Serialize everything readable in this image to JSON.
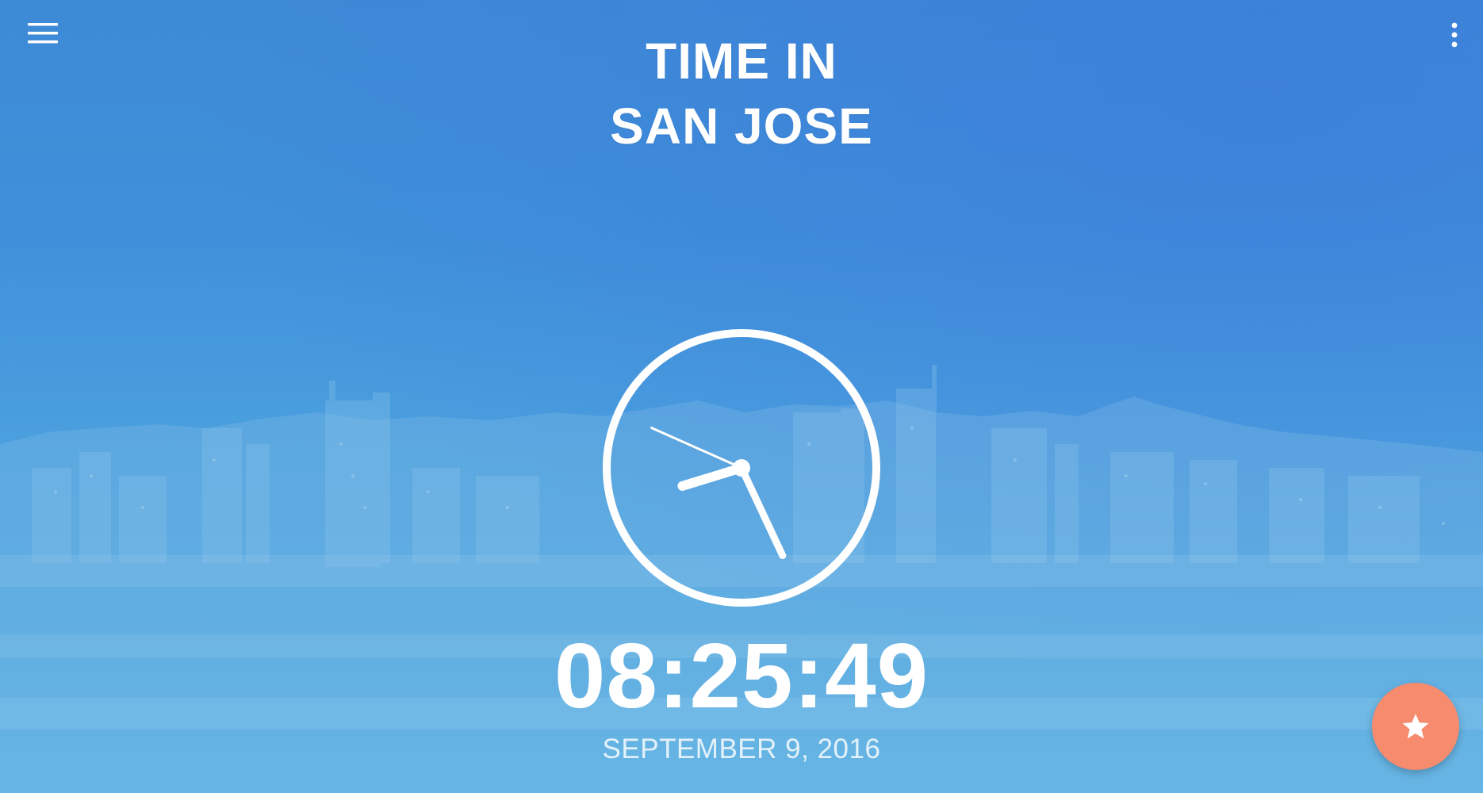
{
  "header": {
    "title_line1": "TIME IN",
    "title_line2": "SAN JOSE",
    "menu_icon": "hamburger-menu-icon",
    "overflow_icon": "more-vert-icon"
  },
  "clock": {
    "analog_hours": 8,
    "analog_minutes": 25,
    "analog_seconds": 49
  },
  "time_display": {
    "time": "08:25:49",
    "date": "SEPTEMBER 9, 2016"
  },
  "fab": {
    "icon": "star-icon",
    "color": "#f78b6d"
  },
  "colors": {
    "background_top": "#3d8ad6",
    "background_bottom": "#5ab4e3",
    "foreground": "#ffffff"
  }
}
